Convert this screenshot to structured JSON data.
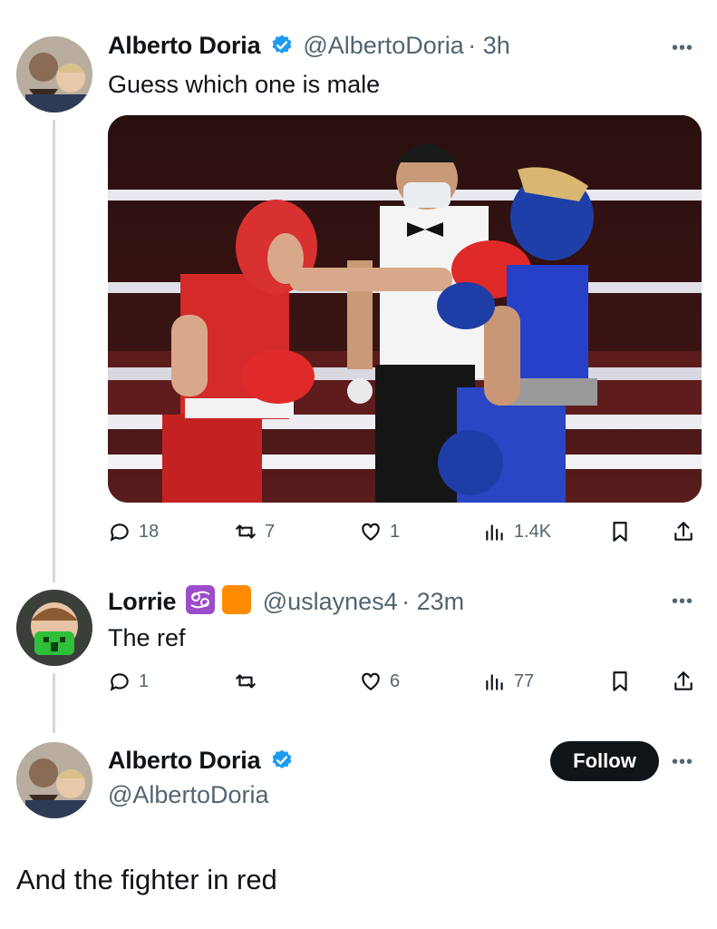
{
  "tweet1": {
    "name": "Alberto Doria",
    "handle": "@AlbertoDoria",
    "time": "· 3h",
    "text": "Guess which one is male",
    "actions": {
      "replies": "18",
      "retweets": "7",
      "likes": "1",
      "views": "1.4K"
    }
  },
  "reply": {
    "name": "Lorrie",
    "handle": "@uslaynes4",
    "time": "· 23m",
    "text": "The ref",
    "actions": {
      "replies": "1",
      "retweets": "",
      "likes": "6",
      "views": "77"
    }
  },
  "tweet2": {
    "name": "Alberto Doria",
    "handle": "@AlbertoDoria",
    "follow_label": "Follow",
    "text": "And the fighter in red"
  },
  "icons": {
    "more": "more-dots-icon",
    "verified": "verified-badge-icon",
    "reply": "reply-icon",
    "retweet": "retweet-icon",
    "like": "like-icon",
    "views": "views-icon",
    "bookmark": "bookmark-icon",
    "share": "share-icon",
    "zodiac": "cancer-zodiac-icon",
    "square": "orange-square-icon"
  },
  "colors": {
    "verified": "#1d9bf0",
    "text": "#0f1419",
    "muted": "#536471",
    "zodiac": "#9b4dca",
    "orange": "#ff8c00"
  }
}
